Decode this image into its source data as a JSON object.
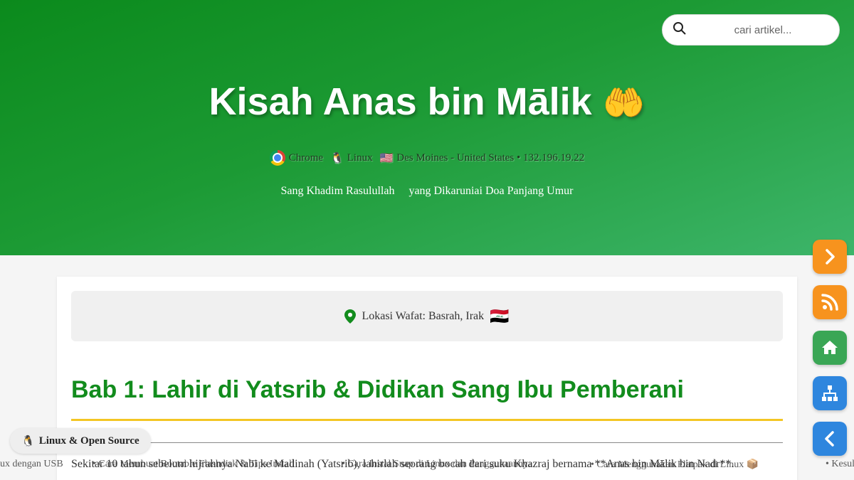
{
  "search": {
    "placeholder": "cari artikel..."
  },
  "header": {
    "title": "Kisah Anas bin Mālik",
    "title_emoji": "🤲",
    "meta": {
      "browser": "Chrome",
      "os": "Linux",
      "os_emoji": "🐧",
      "flag": "🇺🇸",
      "location": "Des Moines - United States • 132.196.19.22"
    },
    "tagline": [
      "Sang Khadim Rasulullah",
      "yang Dikaruniai Doa Panjang Umur"
    ]
  },
  "article": {
    "location": {
      "label": "Lokasi Wafat: Basrah, Irak",
      "flag": "🇮🇶"
    },
    "chapter_title": "Bab 1: Lahir di Yatsrib & Didikan Sang Ibu Pemberani",
    "paragraph": "Sekitar 10 tahun sebelum hijrahnya Nabi ke Madinah (Yatsrib), lahirlah seorang bocah dari suku Khazraj bernama **Anas bin Mālik bin Nadr**."
  },
  "ticker": [
    "ux dengan USB",
    "• Cara Membuat Bootable Flashdisk & Tips Install",
    "• Cara Instal Snap di Linux dan Penggunaannya",
    "• Cara Menggunakan Flatpak di Linux 📦",
    "• Kesul"
  ],
  "badge": {
    "emoji": "🐧",
    "label": "Linux & Open Source"
  },
  "fabs": {
    "next": "next",
    "rss": "rss",
    "home": "home",
    "sitemap": "sitemap",
    "back": "back"
  },
  "colors": {
    "accent_green": "#128c1d",
    "gold": "#f3c623",
    "fab_orange": "#f7931e",
    "fab_green": "#3aa655",
    "fab_blue": "#2e86de"
  }
}
